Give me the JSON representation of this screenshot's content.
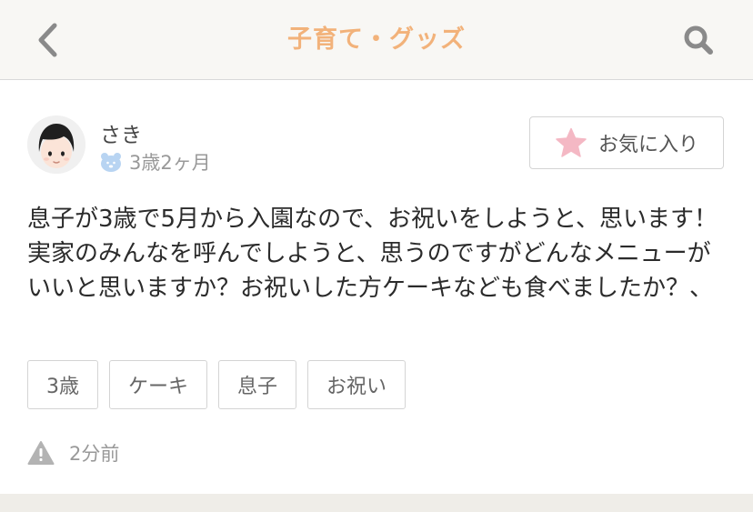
{
  "header": {
    "title": "子育て・グッズ",
    "title_color": "#f2b27a",
    "back_icon": "chevron-left-icon",
    "search_icon": "search-icon"
  },
  "post": {
    "author": {
      "name": "さき",
      "child_age": "3歳2ヶ月",
      "age_icon": "bear-icon"
    },
    "favorite": {
      "label": "お気に入り",
      "icon": "star-icon",
      "icon_color": "#f4b8c4"
    },
    "body": "息子が3歳で5月から入園なので、お祝いをしようと、思います！実家のみんなを呼んでしようと、思うのですがどんなメニューがいいと思いますか？お祝いした方ケーキなども食べましたか？、",
    "tags": [
      "3歳",
      "ケーキ",
      "息子",
      "お祝い"
    ],
    "posted_ago": "2分前",
    "report_icon": "warning-icon"
  }
}
